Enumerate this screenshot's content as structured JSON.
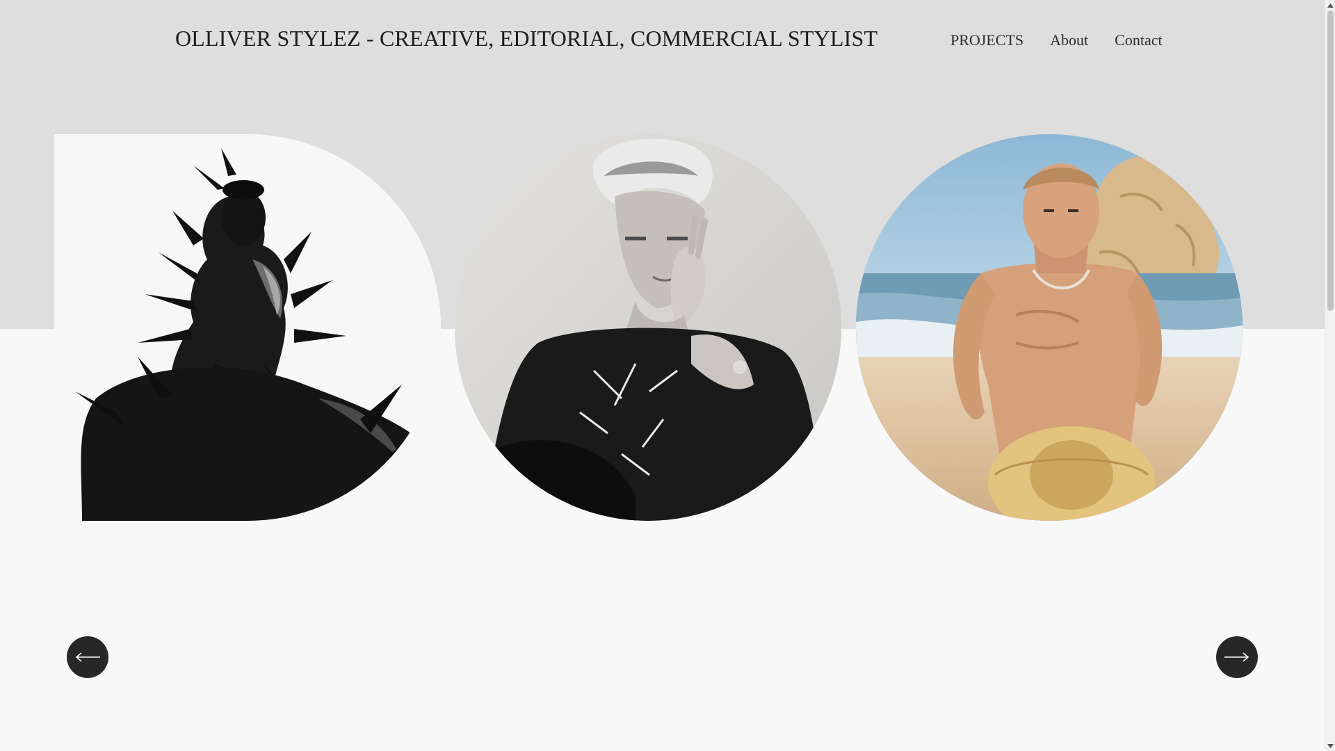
{
  "header": {
    "title": "OLLIVER STYLEZ - CREATIVE, EDITORIAL, COMMERCIAL STYLIST",
    "background": "#dedede"
  },
  "nav": {
    "items": [
      {
        "label": "PROJECTS"
      },
      {
        "label": "About"
      },
      {
        "label": "Contact"
      }
    ]
  },
  "gallery": {
    "slides": [
      {
        "name": "portrait-spiked-armor",
        "style": "black-and-white"
      },
      {
        "name": "portrait-hand-on-face",
        "style": "black-and-white"
      },
      {
        "name": "portrait-beach-hat",
        "style": "color"
      }
    ],
    "prev_icon": "arrow-left-icon",
    "next_icon": "arrow-right-icon"
  },
  "colors": {
    "page_background": "#f8f8f8",
    "text": "#1e1e1e",
    "arrow_button": "#272727"
  }
}
